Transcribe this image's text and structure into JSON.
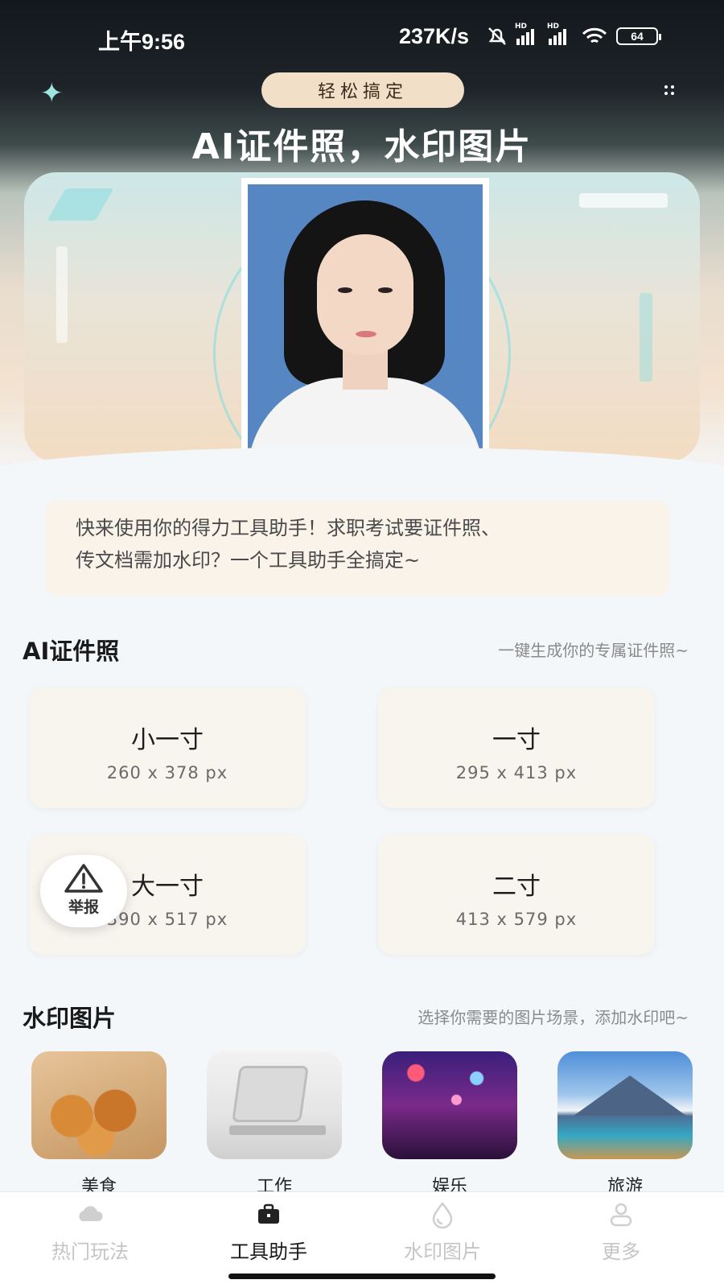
{
  "status_bar": {
    "time": "上午9:56",
    "net_speed": "237K/s",
    "signal_label": "HD",
    "battery": "64"
  },
  "hero": {
    "pill": "轻松搞定",
    "title": "AI证件照，水印图片"
  },
  "intro": {
    "line1": "快来使用你的得力工具助手！求职考试要证件照、",
    "line2": "传文档需加水印？一个工具助手全搞定~"
  },
  "id_photo_section": {
    "title": "AI证件照",
    "subtitle": "一键生成你的专属证件照~",
    "sizes": [
      {
        "name": "小一寸",
        "dimensions": "260 x 378 px"
      },
      {
        "name": "一寸",
        "dimensions": "295 x 413 px"
      },
      {
        "name": "大一寸",
        "dimensions": "390 x 517 px"
      },
      {
        "name": "二寸",
        "dimensions": "413 x 579 px"
      }
    ]
  },
  "report_button": {
    "label": "举报",
    "icon": "warning-icon"
  },
  "watermark_section": {
    "title": "水印图片",
    "subtitle": "选择你需要的图片场景，添加水印吧~",
    "scenes": [
      {
        "label": "美食"
      },
      {
        "label": "工作"
      },
      {
        "label": "娱乐"
      },
      {
        "label": "旅游"
      }
    ]
  },
  "bottom_nav": {
    "items": [
      {
        "label": "热门玩法",
        "icon": "cloud-icon",
        "active": false
      },
      {
        "label": "工具助手",
        "icon": "briefcase-icon",
        "active": true
      },
      {
        "label": "水印图片",
        "icon": "droplet-icon",
        "active": false
      },
      {
        "label": "更多",
        "icon": "person-icon",
        "active": false
      }
    ]
  },
  "colors": {
    "accent_pill": "#f1dfc7",
    "card_bg": "#f8f4ee",
    "page_bg": "#f4f7fa",
    "active_nav": "#1a1a1a",
    "inactive_nav": "#c5c5c5"
  }
}
